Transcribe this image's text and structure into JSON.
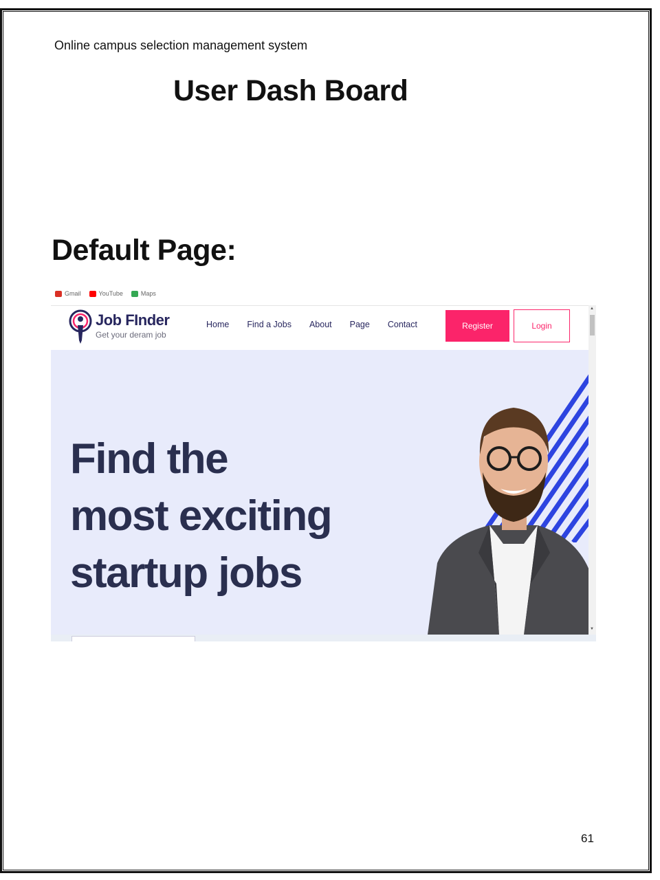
{
  "document": {
    "header": "Online campus selection management system",
    "title": "User Dash Board",
    "section_heading": "Default Page:",
    "page_number": "61"
  },
  "screenshot": {
    "bookmarks": [
      {
        "label": "Gmail",
        "icon": "gmail-icon",
        "color": "#d93025"
      },
      {
        "label": "YouTube",
        "icon": "youtube-icon",
        "color": "#ff0000"
      },
      {
        "label": "Maps",
        "icon": "maps-icon",
        "color": "#34a853"
      }
    ],
    "brand": {
      "name": "Job FInder",
      "tagline": "Get your deram job"
    },
    "nav": [
      "Home",
      "Find a Jobs",
      "About",
      "Page",
      "Contact"
    ],
    "register_label": "Register",
    "login_label": "Login",
    "hero_lines": [
      "Find the",
      "most exciting",
      "startup jobs"
    ],
    "colors": {
      "accent": "#fb246a",
      "navy": "#2a2f4f",
      "hero_bg": "#e8ebfb",
      "stripe": "#2d44e0"
    }
  }
}
